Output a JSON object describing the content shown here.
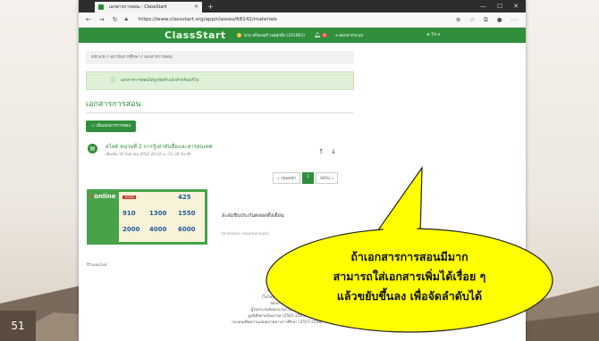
{
  "slide": {
    "number": "51"
  },
  "browser": {
    "tab_title": "เอกสารการสอน - ClassStart",
    "new_tab": "+",
    "url": "https://www.classstart.org/app/classes/68142/materials",
    "window_controls": [
      "—",
      "☐",
      "✕"
    ]
  },
  "app": {
    "brand": "ClassStart",
    "user": "นาย สกิลเลอร์ เจอทุกสิ่ง (201903)",
    "notifications": "0",
    "logout": "ออกจากระบบ",
    "language": "TH"
  },
  "breadcrumb": "หน้าแรก / สถาบันการศึกษา / เอกสารการสอน",
  "alert": "เอกสารการสอนได้ถูกจัดทำแล้วสำหรับแก้ไข",
  "section_title": "เอกสารการสอน",
  "add_button": "+ เพิ่มเอกสารการสอน",
  "material": {
    "title": "สไลด์ หน่วยที่ 2 การรู้เท่าทันสื่อและสารสนเทศ",
    "meta": "เพิ่มเมื่อ 16 กันยายน 2022 20:22 น. (1s 28 วินาที)",
    "up": "↑",
    "down": "↓"
  },
  "pagination": {
    "prev": "« ก่อนหน้า",
    "current": "1",
    "next": "ถัดไป »"
  },
  "ad": {
    "brand_c": "c",
    "brand": "online",
    "prices": [
      "425",
      "910",
      "1300",
      "1550",
      "2000",
      "4000",
      "6000"
    ],
    "chip": "10000"
  },
  "side_text": "สะสมชิบประกันตลอดทั้งเดือน",
  "side_sub": "มีรายได้ทุกการตอบรับตามหน้า",
  "left_label": "รีวิวออนไลน์",
  "footer": [
    "ClassStart",
    "เว็บไซต์การจัดการ",
    "สอบถาม",
    "ผู้ไม่ประสงค์ออกนามร่วมกันการ",
    "มูลนิธิสยามกัมมาจล (2561-2563)",
    "กองทุนเพื่อความเสมอภาคทางการศึกษา (2557-2558)"
  ],
  "callout": {
    "lines": [
      "ถ้าเอกสารการสอนมีมาก",
      "สามารถใส่เอกสารเพิ่มได้เรื่อย ๆ",
      "แล้วขยับขึ้นลง เพื่อจัดลำดับได้"
    ],
    "fill": "#ffff00"
  }
}
